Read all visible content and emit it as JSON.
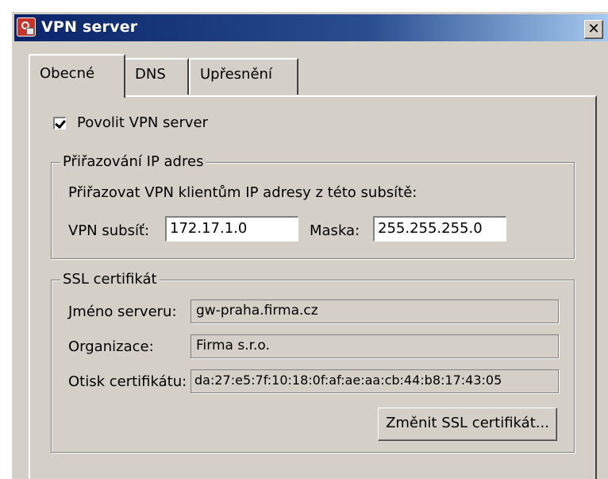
{
  "window": {
    "title": "VPN server",
    "close_label": "✕"
  },
  "tabs": [
    {
      "label": "Obecné",
      "active": true
    },
    {
      "label": "DNS",
      "active": false
    },
    {
      "label": "Upřesnění",
      "active": false
    }
  ],
  "enable_checkbox": {
    "label": "Povolit VPN server",
    "checked": true
  },
  "ip_group": {
    "legend": "Přiřazování IP adres",
    "description": "Přiřazovat VPN klientům IP adresy z této subsítě:",
    "subnet_label": "VPN subsíť:",
    "subnet_value": "172.17.1.0",
    "mask_label": "Maska:",
    "mask_value": "255.255.255.0"
  },
  "ssl_group": {
    "legend": "SSL certifikát",
    "server_name_label": "Jméno serveru:",
    "server_name_value": "gw-praha.firma.cz",
    "organization_label": "Organizace:",
    "organization_value": "Firma s.r.o.",
    "fingerprint_label": "Otisk certifikátu:",
    "fingerprint_value": "da:27:e5:7f:10:18:0f:af:ae:aa:cb:44:b8:17:43:05",
    "change_button": "Změnit SSL certifikát..."
  }
}
